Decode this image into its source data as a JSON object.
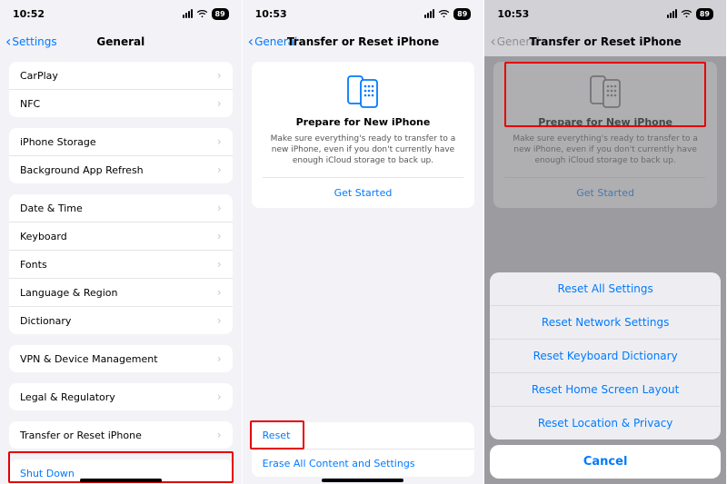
{
  "p1": {
    "time": "10:52",
    "batt": "89",
    "back": "Settings",
    "title": "General",
    "g1": [
      "CarPlay",
      "NFC"
    ],
    "g2": [
      "iPhone Storage",
      "Background App Refresh"
    ],
    "g3": [
      "Date & Time",
      "Keyboard",
      "Fonts",
      "Language & Region",
      "Dictionary"
    ],
    "g4": [
      "VPN & Device Management"
    ],
    "g5": [
      "Legal & Regulatory"
    ],
    "g6": [
      "Transfer or Reset iPhone"
    ],
    "shutdown": "Shut Down"
  },
  "p2": {
    "time": "10:53",
    "batt": "89",
    "back": "General",
    "title": "Transfer or Reset iPhone",
    "card": {
      "h": "Prepare for New iPhone",
      "p": "Make sure everything's ready to transfer to a new iPhone, even if you don't currently have enough iCloud storage to back up.",
      "cta": "Get Started"
    },
    "reset": "Reset",
    "erase": "Erase All Content and Settings"
  },
  "p3": {
    "time": "10:53",
    "batt": "89",
    "back": "General",
    "title": "Transfer or Reset iPhone",
    "opts": [
      "Reset All Settings",
      "Reset Network Settings",
      "Reset Keyboard Dictionary",
      "Reset Home Screen Layout",
      "Reset Location & Privacy"
    ],
    "cancel": "Cancel"
  }
}
